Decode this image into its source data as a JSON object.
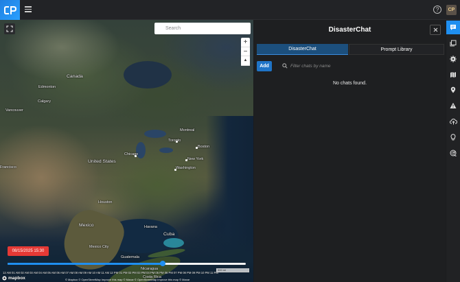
{
  "app": {
    "logo_text": "cP",
    "avatar_initials": "CP",
    "help_glyph": "?"
  },
  "icons": {
    "menu": "hamburger-icon",
    "help": "help-circle-icon",
    "fullscreen": "fullscreen-icon",
    "search": "search-icon",
    "close": "close-icon",
    "rail": [
      "chat-icon",
      "library-icon",
      "gear-icon",
      "map-icon",
      "location-pin-icon",
      "warning-icon",
      "cloud-upload-icon",
      "lightbulb-icon",
      "radar-icon"
    ]
  },
  "map": {
    "search_placeholder": "Search",
    "zoom_in": "+",
    "zoom_out": "−",
    "compass": "▲",
    "labels": {
      "canada": "Canada",
      "edmonton": "Edmonton",
      "calgary": "Calgary",
      "vancouver": "Vancouver",
      "montreal": "Montreal",
      "toronto": "Toronto",
      "boston": "Boston",
      "chicago": "Chicago",
      "new_york": "New York",
      "united_states": "United States",
      "washington": "Washington",
      "francisco": "Francisco",
      "houston": "Houston",
      "mexico": "Mexico",
      "havana": "Havana",
      "cuba": "Cuba",
      "mexico_city": "Mexico City",
      "guatemala": "Guatemala",
      "nicaragua": "Nicaragua",
      "costa_rica": "Costa Rica"
    },
    "date_badge": "08/15/2025 15:30",
    "timeline_progress": 0.65,
    "timeline_ticks": "12 AM 01 AM 02 AM 03 AM 04 AM 05 AM 06 AM 07 AM 08 AM 09 AM 10 AM 11 AM 12 PM 01 PM 02 PM 03 PM 04 PM 05 PM 06 PM 07 PM 08 PM 09 PM 10 PM 11 PM",
    "scale_label": "300 mi",
    "mapbox_logo": "mapbox",
    "attribution": "© Mapbox © OpenStreetMap Improve this map © Maxar © OpenStreetMap Improve this map © Maxar"
  },
  "panel": {
    "title": "DisasterChat",
    "tabs": [
      "DisasterChat",
      "Prompt Library"
    ],
    "add_label": "Add",
    "filter_placeholder": "Filter chats by name",
    "empty_text": "No chats found."
  },
  "colors": {
    "accent": "#1f8ff0",
    "date_badge": "#e53935",
    "active_tab": "#1c4f7d"
  }
}
